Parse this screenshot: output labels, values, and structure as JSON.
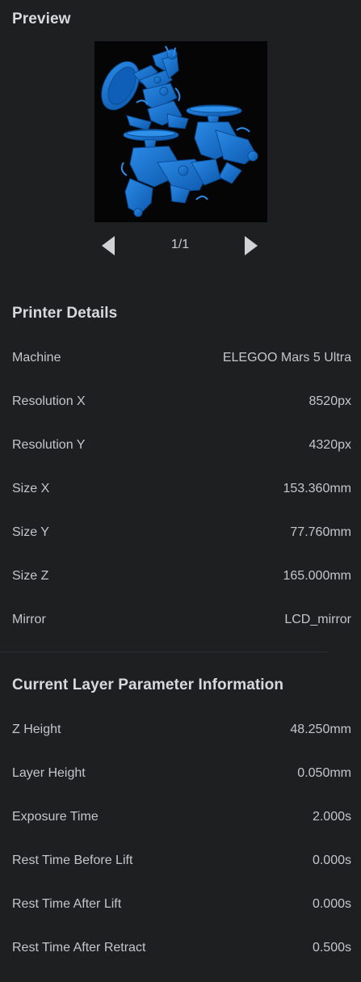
{
  "preview": {
    "title": "Preview",
    "page_indicator": "1/1"
  },
  "printer_details": {
    "title": "Printer Details",
    "rows": [
      {
        "label": "Machine",
        "value": "ELEGOO Mars 5 Ultra"
      },
      {
        "label": "Resolution X",
        "value": "8520px"
      },
      {
        "label": "Resolution Y",
        "value": "4320px"
      },
      {
        "label": "Size X",
        "value": "153.360mm"
      },
      {
        "label": "Size Y",
        "value": "77.760mm"
      },
      {
        "label": "Size Z",
        "value": "165.000mm"
      },
      {
        "label": "Mirror",
        "value": "LCD_mirror"
      }
    ]
  },
  "layer_info": {
    "title": "Current Layer Parameter Information",
    "rows": [
      {
        "label": "Z Height",
        "value": "48.250mm"
      },
      {
        "label": "Layer Height",
        "value": "0.050mm"
      },
      {
        "label": "Exposure Time",
        "value": "2.000s"
      },
      {
        "label": "Rest Time Before Lift",
        "value": "0.000s"
      },
      {
        "label": "Rest Time After Lift",
        "value": "0.000s"
      },
      {
        "label": "Rest Time After Retract",
        "value": "0.500s"
      }
    ]
  },
  "icons": {
    "prev": "chevron-left-icon",
    "next": "chevron-right-icon"
  },
  "colors": {
    "background": "#1e1f21",
    "model_blue": "#1a73c9",
    "preview_background": "#050505",
    "arrow": "#d0d2d6"
  }
}
